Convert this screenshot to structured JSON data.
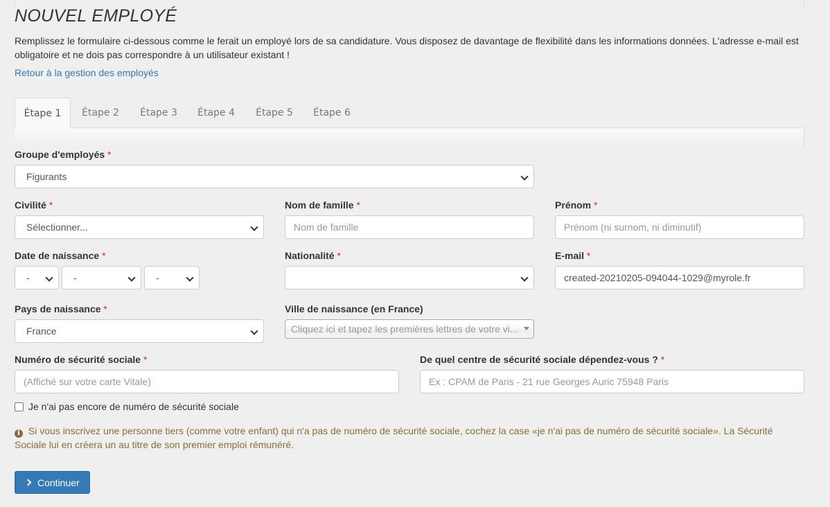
{
  "page": {
    "title": "NOUVEL EMPLOYÉ",
    "intro": "Remplissez le formulaire ci-dessous comme le ferait un employé lors de sa candidature. Vous disposez de davantage de flexibilité dans les informations données. L'adresse e-mail est obligatoire et ne dois pas correspondre à un utilisateur existant !",
    "back_link": "Retour à la gestion des employés"
  },
  "tabs": [
    {
      "label": "Étape 1",
      "active": true
    },
    {
      "label": "Étape 2",
      "active": false
    },
    {
      "label": "Étape 3",
      "active": false
    },
    {
      "label": "Étape 4",
      "active": false
    },
    {
      "label": "Étape 5",
      "active": false
    },
    {
      "label": "Étape 6",
      "active": false
    }
  ],
  "form": {
    "required_mark": "*",
    "group": {
      "label": "Groupe d'employés",
      "value": "Figurants"
    },
    "civility": {
      "label": "Civilité",
      "value": "Sélectionner..."
    },
    "last_name": {
      "label": "Nom de famille",
      "placeholder": "Nom de famille"
    },
    "first_name": {
      "label": "Prénom",
      "placeholder": "Prénom (ni surnom, ni diminutif)"
    },
    "birth_date": {
      "label": "Date de naissance",
      "day": "-",
      "month": "-",
      "year": "-"
    },
    "nationality": {
      "label": "Nationalité",
      "value": ""
    },
    "email": {
      "label": "E-mail",
      "value": "created-20210205-094044-1029@myrole.fr"
    },
    "birth_country": {
      "label": "Pays de naissance",
      "value": "France"
    },
    "birth_city": {
      "label": "Ville de naissance (en France)",
      "placeholder": "Cliquez ici et tapez les premières lettres de votre vi..."
    },
    "ssn": {
      "label": "Numéro de sécurité sociale",
      "placeholder": "(Affiché sur votre carte Vitale)"
    },
    "ssn_center": {
      "label": "De quel centre de sécurité sociale dépendez-vous ?",
      "placeholder": "Ex : CPAM de Paris - 21 rue Georges Auric 75948 Paris"
    },
    "no_ssn_checkbox": {
      "label": "Je n'ai pas encore de numéro de sécurité sociale",
      "checked": false
    },
    "info": "Si vous inscrivez une personne tiers (comme votre enfant) qui n'a pas de numéro de sécurité sociale, cochez la case «je n'ai pas de numéro de sécurité sociale». La Sécurité Sociale lui en créera un au titre de son premier emploi rémunéré.",
    "continue_button": "Continuer"
  },
  "colors": {
    "primary": "#337ab7",
    "required": "#c9302c",
    "info_text": "#8a6d3b"
  },
  "icons": {
    "info": "info-circle-icon",
    "continue": "chevron-right-icon"
  }
}
